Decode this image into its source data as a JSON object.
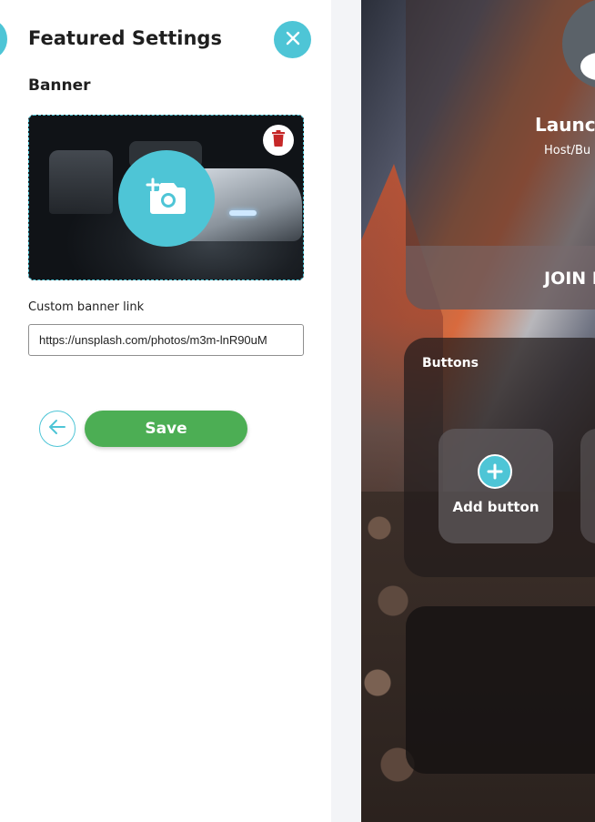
{
  "panel": {
    "title": "Featured Settings",
    "banner_label": "Banner",
    "custom_link_label": "Custom banner link",
    "custom_link_value": "https://unsplash.com/photos/m3m-lnR90uM",
    "save_label": "Save"
  },
  "preview": {
    "profile_name": "Launch",
    "profile_role": "Host/Bu",
    "join_label": "JOIN I",
    "buttons_title": "Buttons",
    "add_button_label": "Add button"
  },
  "colors": {
    "accent": "#4ec5d6",
    "save": "#4cae54",
    "delete": "#c62828"
  },
  "icons": [
    "close-icon",
    "trash-icon",
    "add-photo-icon",
    "arrow-left-icon",
    "plus-icon"
  ]
}
